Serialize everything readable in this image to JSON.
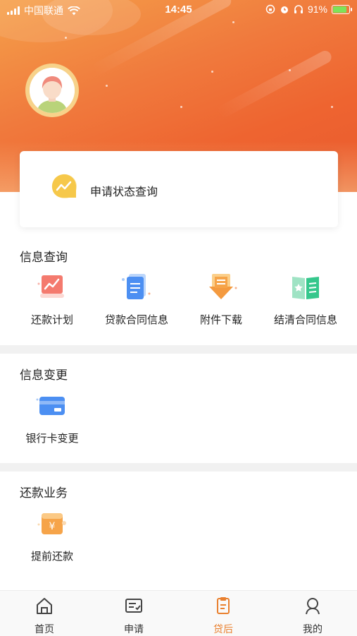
{
  "status_bar": {
    "carrier": "中国联通",
    "time": "14:45",
    "battery": "91%"
  },
  "status_card": {
    "label": "申请状态查询"
  },
  "sections": [
    {
      "title": "信息查询",
      "items": [
        {
          "label": "还款计划",
          "icon": "repayment-plan-icon"
        },
        {
          "label": "贷款合同信息",
          "icon": "loan-contract-icon"
        },
        {
          "label": "附件下载",
          "icon": "attachment-download-icon"
        },
        {
          "label": "结清合同信息",
          "icon": "settled-contract-icon"
        }
      ]
    },
    {
      "title": "信息变更",
      "items": [
        {
          "label": "银行卡变更",
          "icon": "bank-card-icon"
        }
      ]
    },
    {
      "title": "还款业务",
      "items": [
        {
          "label": "提前还款",
          "icon": "early-repayment-icon"
        }
      ]
    }
  ],
  "tabbar": {
    "items": [
      {
        "label": "首页",
        "icon": "home-icon"
      },
      {
        "label": "申请",
        "icon": "apply-icon"
      },
      {
        "label": "贷后",
        "icon": "clipboard-icon"
      },
      {
        "label": "我的",
        "icon": "profile-icon"
      }
    ],
    "active": "贷后"
  },
  "colors": {
    "accent": "#e9802f",
    "hero_start": "#f5a04a",
    "hero_end": "#e95a2e"
  }
}
